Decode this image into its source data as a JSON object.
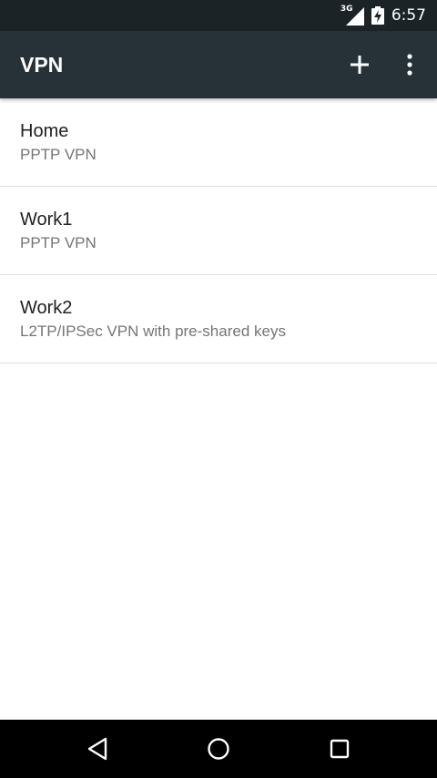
{
  "status_bar": {
    "network_type": "3G",
    "time": "6:57",
    "icons": [
      "signal-icon",
      "battery-charging-icon"
    ]
  },
  "app_bar": {
    "title": "VPN",
    "actions": [
      {
        "name": "add",
        "icon": "plus-icon"
      },
      {
        "name": "more-options",
        "icon": "overflow-menu-icon"
      }
    ]
  },
  "vpn_list": [
    {
      "name": "Home",
      "type": "PPTP VPN"
    },
    {
      "name": "Work1",
      "type": "PPTP VPN"
    },
    {
      "name": "Work2",
      "type": "L2TP/IPSec VPN with pre-shared keys"
    }
  ],
  "nav_bar": {
    "buttons": [
      {
        "name": "back",
        "icon": "back-triangle-icon"
      },
      {
        "name": "home",
        "icon": "home-circle-icon"
      },
      {
        "name": "recents",
        "icon": "recents-square-icon"
      }
    ]
  },
  "colors": {
    "status_bar_bg": "#1b2327",
    "app_bar_bg": "#263238",
    "list_bg": "#ffffff",
    "primary_text": "#212121",
    "secondary_text": "#757575",
    "divider": "#dfdfdf",
    "nav_bar_bg": "#000000"
  }
}
